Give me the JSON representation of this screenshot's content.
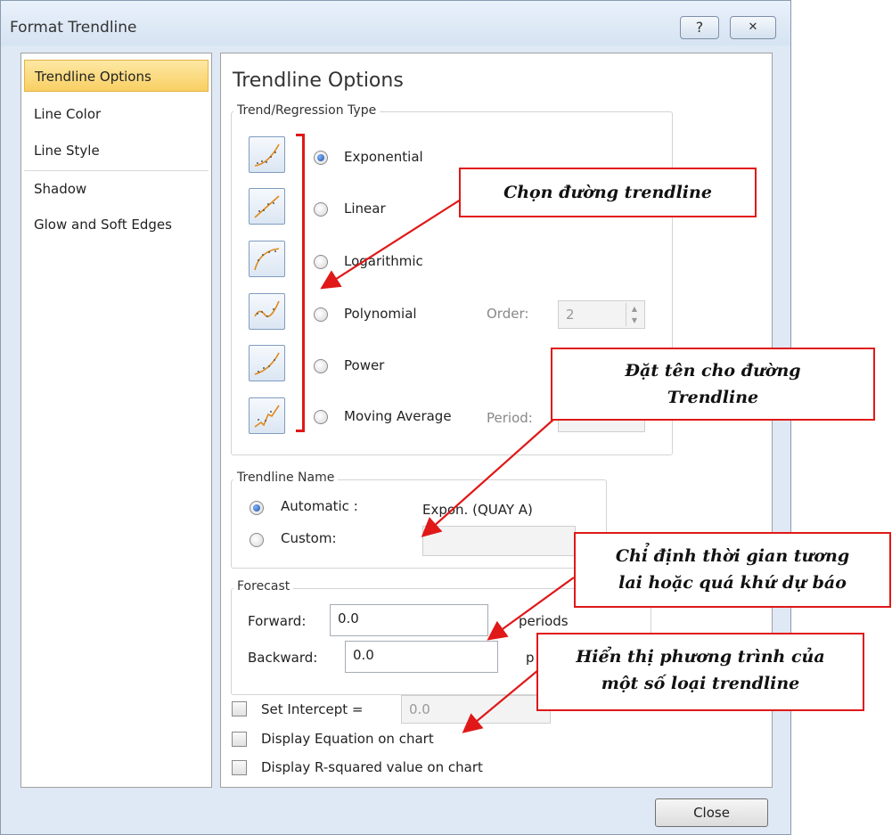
{
  "window": {
    "title": "Format Trendline",
    "help_label": "?",
    "close_label": "✕"
  },
  "sidebar": {
    "items": [
      {
        "label": "Trendline Options"
      },
      {
        "label": "Line Color"
      },
      {
        "label": "Line Style"
      },
      {
        "label": "Shadow"
      },
      {
        "label": "Glow and Soft Edges"
      }
    ]
  },
  "main": {
    "heading": "Trendline Options",
    "trend_group_label": "Trend/Regression Type",
    "types": [
      {
        "label": "Exponential",
        "selected": true
      },
      {
        "label": "Linear",
        "selected": false
      },
      {
        "label": "Logarithmic",
        "selected": false
      },
      {
        "label": "Polynomial",
        "selected": false
      },
      {
        "label": "Power",
        "selected": false
      },
      {
        "label": "Moving Average",
        "selected": false
      }
    ],
    "order_label": "Order:",
    "order_value": "2",
    "period_label": "Period:",
    "name_group_label": "Trendline Name",
    "automatic_label": "Automatic :",
    "automatic_value": "Expon. (QUAY A)",
    "custom_label": "Custom:",
    "forecast_group_label": "Forecast",
    "forward_label": "Forward:",
    "forward_value": "0.0",
    "forward_unit": "periods",
    "backward_label": "Backward:",
    "backward_value": "0.0",
    "backward_unit": "p",
    "set_intercept_label": "Set Intercept =",
    "set_intercept_value": "0.0",
    "display_equation_label": "Display Equation on chart",
    "display_r2_label": "Display R-squared value on chart"
  },
  "footer": {
    "close_button": "Close"
  },
  "annotations": {
    "choose_trendline": "Chọn đường trendline",
    "name_line1": "Đặt tên cho đường",
    "name_line2": "Trendline",
    "forecast_line1": "Chỉ định thời gian tương",
    "forecast_line2": "lai hoặc quá khứ dự báo",
    "equation_line1": "Hiển thị phương trình của",
    "equation_line2": "một số loại trendline"
  },
  "colors": {
    "callout_border": "#e01818",
    "selected_item": "#f9cf63",
    "dialog_bg": "#dfe9f5"
  }
}
